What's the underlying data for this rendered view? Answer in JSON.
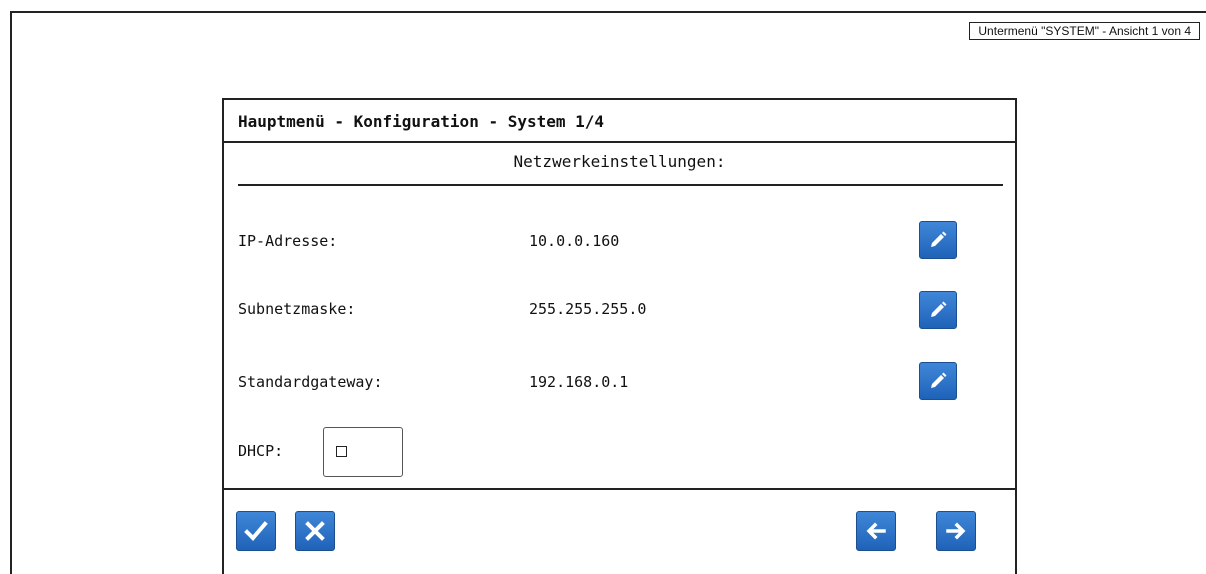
{
  "view_tag": "Untermenü \"SYSTEM\" - Ansicht 1 von 4",
  "panel": {
    "title": "Hauptmenü - Konfiguration - System 1/4",
    "section_title": "Netzwerkeinstellungen:"
  },
  "fields": {
    "ip": {
      "label": "IP-Adresse:",
      "value": "10.0.0.160",
      "icon": "pencil-icon"
    },
    "subnet": {
      "label": "Subnetzmaske:",
      "value": "255.255.255.0",
      "icon": "pencil-icon"
    },
    "gateway": {
      "label": "Standardgateway:",
      "value": "192.168.0.1",
      "icon": "pencil-icon"
    },
    "dhcp": {
      "label": "DHCP:",
      "checked": false
    }
  },
  "footer": {
    "confirm_icon": "checkmark-icon",
    "cancel_icon": "x-icon",
    "back_icon": "arrow-left-icon",
    "forward_icon": "arrow-right-icon"
  },
  "colors": {
    "button_blue": "#2a6fc4",
    "border": "#222222"
  }
}
